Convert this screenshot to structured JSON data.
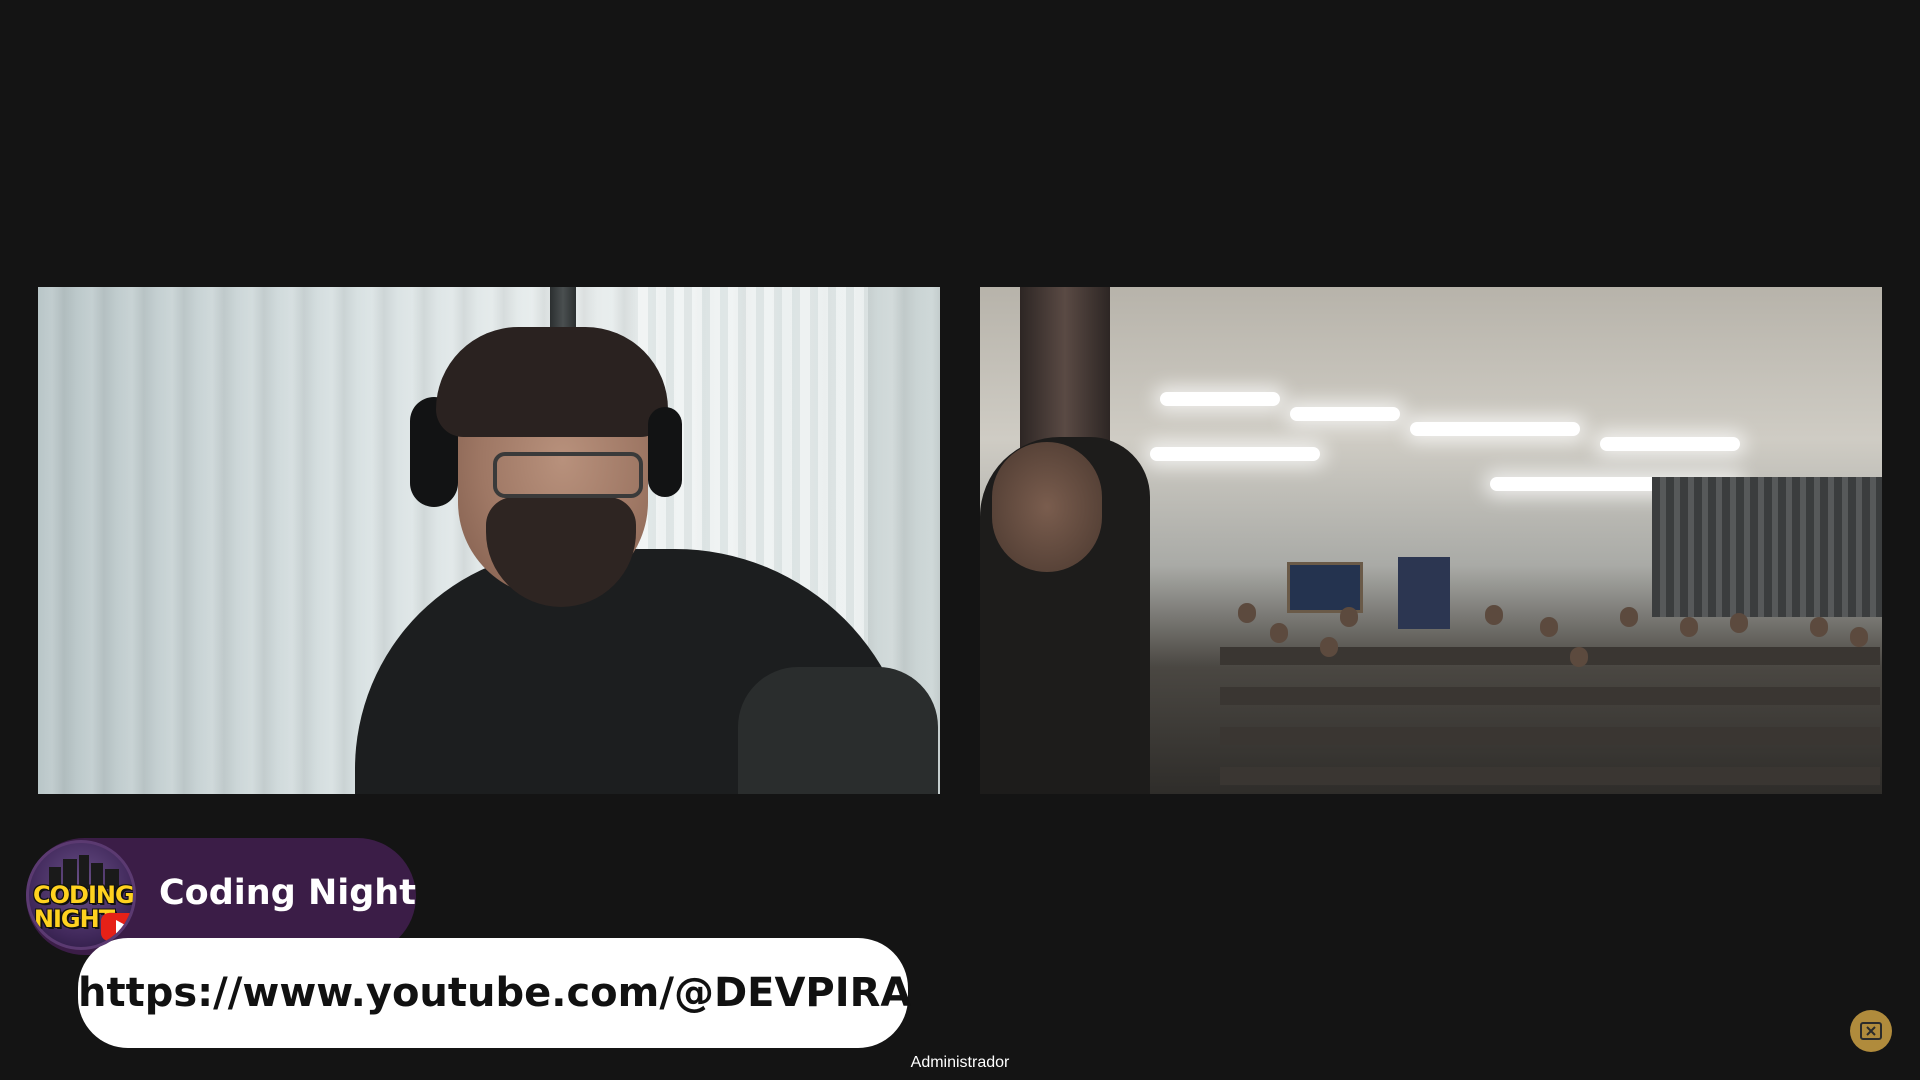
{
  "participants": [
    {
      "id": "presenter",
      "label": ""
    },
    {
      "id": "auditorium",
      "label": ""
    }
  ],
  "brand": {
    "name": "Coding Night",
    "logo_text_line1": "CODING",
    "logo_text_line2": "NIGHT",
    "logo_icon": "youtube-play-icon"
  },
  "url_banner": {
    "text": "https://www.youtube.com/@DEVPIRA"
  },
  "footer": {
    "username": "Administrador"
  },
  "corner_action": {
    "icon": "exit-fullscreen-icon"
  },
  "colors": {
    "background": "#141414",
    "brand_pill": "#3b1d47",
    "url_pill": "#ffffff",
    "logo_text": "#ffd21f",
    "youtube_red": "#e62117",
    "corner_button": "#b08b3c"
  }
}
